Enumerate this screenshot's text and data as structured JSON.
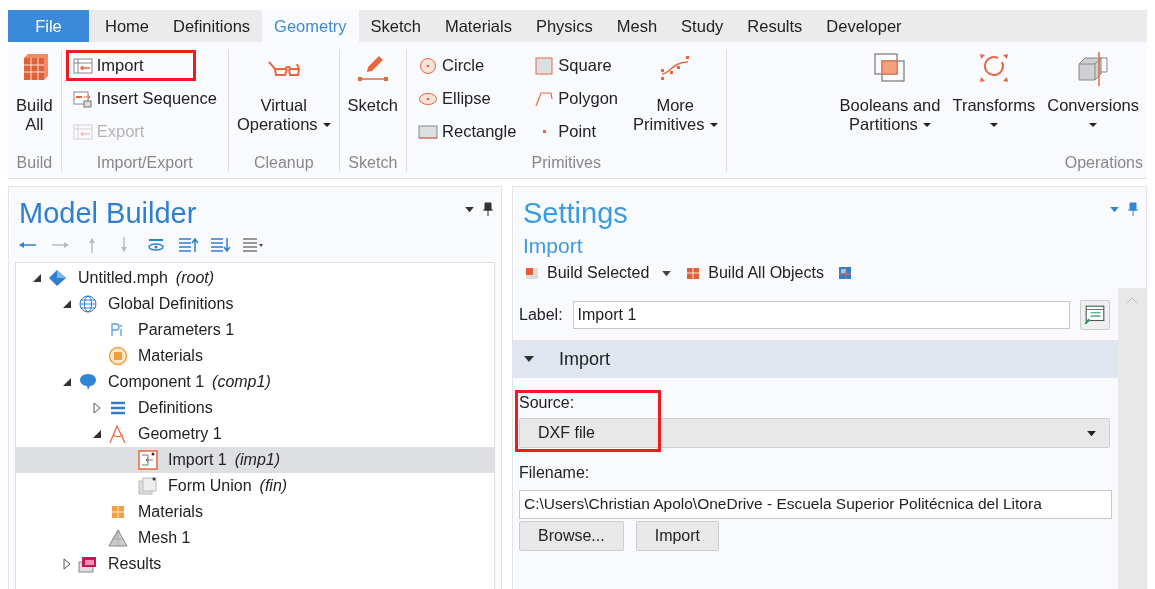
{
  "ribbon": {
    "tabs": [
      {
        "label": "File",
        "kind": "file",
        "selected": false
      },
      {
        "label": "Home",
        "kind": "tab",
        "selected": false
      },
      {
        "label": "Definitions",
        "kind": "tab",
        "selected": false
      },
      {
        "label": "Geometry",
        "kind": "tab",
        "selected": true
      },
      {
        "label": "Sketch",
        "kind": "tab",
        "selected": false
      },
      {
        "label": "Materials",
        "kind": "tab",
        "selected": false
      },
      {
        "label": "Physics",
        "kind": "tab",
        "selected": false
      },
      {
        "label": "Mesh",
        "kind": "tab",
        "selected": false
      },
      {
        "label": "Study",
        "kind": "tab",
        "selected": false
      },
      {
        "label": "Results",
        "kind": "tab",
        "selected": false
      },
      {
        "label": "Developer",
        "kind": "tab",
        "selected": false
      }
    ],
    "groups": [
      {
        "label": "Build",
        "columns": [
          {
            "kind": "large",
            "button": {
              "kind": "build",
              "lines": [
                "Build",
                "All"
              ],
              "dropdown": false
            }
          }
        ]
      },
      {
        "label": "Import/Export",
        "columns": [
          {
            "kind": "small",
            "items": [
              {
                "kind": "import",
                "label": "Import",
                "disabled": false,
                "highlighted": true
              },
              {
                "kind": "sequence",
                "label": "Insert Sequence",
                "disabled": false,
                "highlighted": false
              },
              {
                "kind": "import",
                "label": "Export",
                "disabled": true,
                "highlighted": false
              }
            ]
          }
        ]
      },
      {
        "label": "Cleanup",
        "columns": [
          {
            "kind": "large",
            "button": {
              "kind": "glasses",
              "lines": [
                "Virtual",
                "Operations"
              ],
              "dropdown": true
            }
          }
        ]
      },
      {
        "label": "Sketch",
        "columns": [
          {
            "kind": "large",
            "button": {
              "kind": "pencil",
              "lines": [
                "Sketch"
              ],
              "dropdown": false
            }
          }
        ]
      },
      {
        "label": "Primitives",
        "columns": [
          {
            "kind": "small",
            "items": [
              {
                "kind": "circle",
                "label": "Circle",
                "disabled": false,
                "highlighted": false
              },
              {
                "kind": "ellipse",
                "label": "Ellipse",
                "disabled": false,
                "highlighted": false
              },
              {
                "kind": "rectangle",
                "label": "Rectangle",
                "disabled": false,
                "highlighted": false
              }
            ]
          },
          {
            "kind": "small",
            "items": [
              {
                "kind": "square",
                "label": "Square",
                "disabled": false,
                "highlighted": false
              },
              {
                "kind": "polygon",
                "label": "Polygon",
                "disabled": false,
                "highlighted": false
              },
              {
                "kind": "point",
                "label": "Point",
                "disabled": false,
                "highlighted": false
              }
            ]
          },
          {
            "kind": "large",
            "button": {
              "kind": "curve",
              "lines": [
                "More",
                "Primitives"
              ],
              "dropdown": true
            }
          }
        ]
      },
      {
        "label": "Operations",
        "columns": [
          {
            "kind": "large",
            "button": {
              "kind": "booleans",
              "lines": [
                "Booleans and",
                "Partitions"
              ],
              "dropdown": true
            }
          },
          {
            "kind": "large",
            "button": {
              "kind": "transforms",
              "lines": [
                "Transforms"
              ],
              "dropdown": true
            }
          },
          {
            "kind": "large",
            "button": {
              "kind": "cube",
              "lines": [
                "Conversions"
              ],
              "dropdown": true
            }
          }
        ]
      }
    ]
  },
  "model_builder": {
    "title": "Model Builder",
    "toolbar": [
      {
        "kind": "back",
        "disabled": false
      },
      {
        "kind": "forward",
        "disabled": true
      },
      {
        "kind": "up",
        "disabled": true
      },
      {
        "kind": "down",
        "disabled": true
      },
      {
        "kind": "eye",
        "disabled": false
      },
      {
        "kind": "collapse",
        "disabled": false
      },
      {
        "kind": "expand",
        "disabled": false
      },
      {
        "kind": "list",
        "disabled": false
      }
    ],
    "tree": [
      {
        "label": "Untitled.mph",
        "tag": "(root)",
        "kind": "model",
        "expanded": true,
        "selected": false,
        "children": [
          {
            "label": "Global Definitions",
            "kind": "globe",
            "expanded": true,
            "selected": false,
            "children": [
              {
                "label": "Parameters 1",
                "kind": "pi",
                "selected": false
              },
              {
                "label": "Materials",
                "kind": "materials-ring",
                "selected": false
              }
            ]
          },
          {
            "label": "Component 1",
            "tag": "(comp1)",
            "kind": "component",
            "expanded": true,
            "selected": false,
            "children": [
              {
                "label": "Definitions",
                "kind": "defs",
                "expanded": false,
                "selected": false
              },
              {
                "label": "Geometry 1",
                "kind": "geometry",
                "expanded": true,
                "selected": false,
                "children": [
                  {
                    "label": "Import 1",
                    "tag": "(imp1)",
                    "kind": "import-node",
                    "selected": true
                  },
                  {
                    "label": "Form Union",
                    "tag": "(fin)",
                    "kind": "union-node",
                    "selected": false
                  }
                ]
              },
              {
                "label": "Materials",
                "kind": "materials",
                "selected": false
              },
              {
                "label": "Mesh 1",
                "kind": "mesh",
                "selected": false
              }
            ]
          },
          {
            "label": "Results",
            "kind": "results",
            "expanded": false,
            "selected": false
          }
        ]
      }
    ]
  },
  "settings": {
    "title": "Settings",
    "subtitle": "Import",
    "toolbar": [
      {
        "label": "Build Selected",
        "kind": "build-selected",
        "dropdown": true
      },
      {
        "label": "Build All Objects",
        "kind": "build-all",
        "dropdown": false
      },
      {
        "kind": "nav"
      }
    ],
    "label_field": {
      "label": "Label:",
      "value": "Import 1"
    },
    "section": {
      "title": "Import",
      "expanded": true
    },
    "source": {
      "label": "Source:",
      "value": "DXF file",
      "highlighted": true
    },
    "filename": {
      "label": "Filename:",
      "value": "C:\\Users\\Christian Apolo\\OneDrive - Escuela Superior Politécnica del Litora"
    },
    "buttons": [
      "Browse...",
      "Import"
    ]
  }
}
